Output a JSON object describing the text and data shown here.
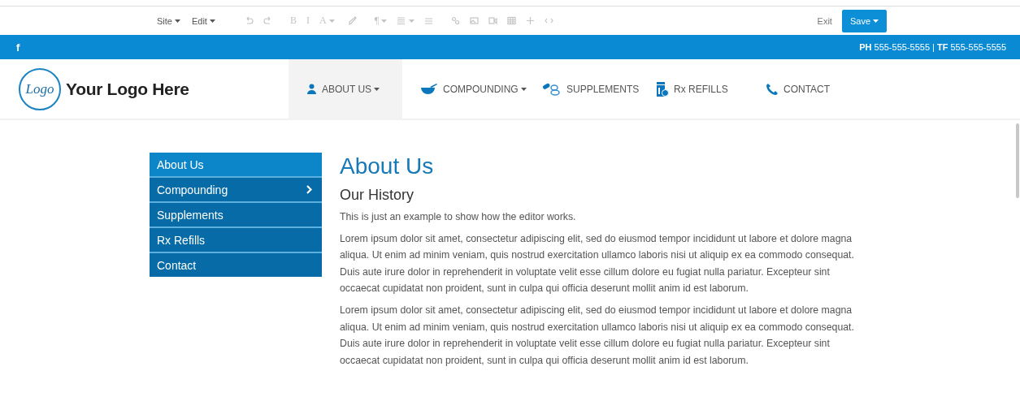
{
  "toolbar": {
    "menus": [
      {
        "label": "Site"
      },
      {
        "label": "Edit"
      }
    ],
    "format_buttons": [
      "B",
      "I",
      "A"
    ],
    "paragraph_button": "¶",
    "disabled": true,
    "exit": "Exit",
    "save": "Save"
  },
  "topbar": {
    "social": "f",
    "phone_label": "PH",
    "phone": "555-555-5555",
    "separator": "|",
    "fax_label": "TF",
    "fax": "555-555-5555"
  },
  "header": {
    "logo_mark": "Logo",
    "logo_text": "Your Logo Here",
    "nav": [
      {
        "label": "ABOUT US",
        "dropdown": true,
        "selected": true
      },
      {
        "label": "COMPOUNDING",
        "dropdown": true,
        "selected": false
      },
      {
        "label": "SUPPLEMENTS",
        "dropdown": false,
        "selected": false
      },
      {
        "label": "Rx REFILLS",
        "dropdown": false,
        "selected": false
      },
      {
        "label": "CONTACT",
        "dropdown": false,
        "selected": false
      }
    ]
  },
  "sidebar": {
    "items": [
      {
        "label": "About Us",
        "selected": true,
        "expandable": false
      },
      {
        "label": "Compounding",
        "selected": false,
        "expandable": true
      },
      {
        "label": "Supplements",
        "selected": false,
        "expandable": false
      },
      {
        "label": "Rx Refills",
        "selected": false,
        "expandable": false
      },
      {
        "label": "Contact",
        "selected": false,
        "expandable": false
      }
    ]
  },
  "article": {
    "title": "About Us",
    "subtitle": "Our History",
    "intro": "This is just an example to show how the editor works.",
    "paragraphs": [
      "Lorem ipsum dolor sit amet, consectetur adipiscing elit, sed do eiusmod tempor incididunt ut labore et dolore magna aliqua. Ut enim ad minim veniam, quis nostrud exercitation ullamco laboris nisi ut aliquip ex ea commodo consequat. Duis aute irure dolor in reprehenderit in voluptate velit esse cillum dolore eu fugiat nulla pariatur. Excepteur sint occaecat cupidatat non proident, sunt in culpa qui officia deserunt mollit anim id est laborum.",
      "Lorem ipsum dolor sit amet, consectetur adipiscing elit, sed do eiusmod tempor incididunt ut labore et dolore magna aliqua. Ut enim ad minim veniam, quis nostrud exercitation ullamco laboris nisi ut aliquip ex ea commodo consequat. Duis aute irure dolor in reprehenderit in voluptate velit esse cillum dolore eu fugiat nulla pariatur. Excepteur sint occaecat cupidatat non proident, sunt in culpa qui officia deserunt mollit anim id est laborum."
    ]
  }
}
